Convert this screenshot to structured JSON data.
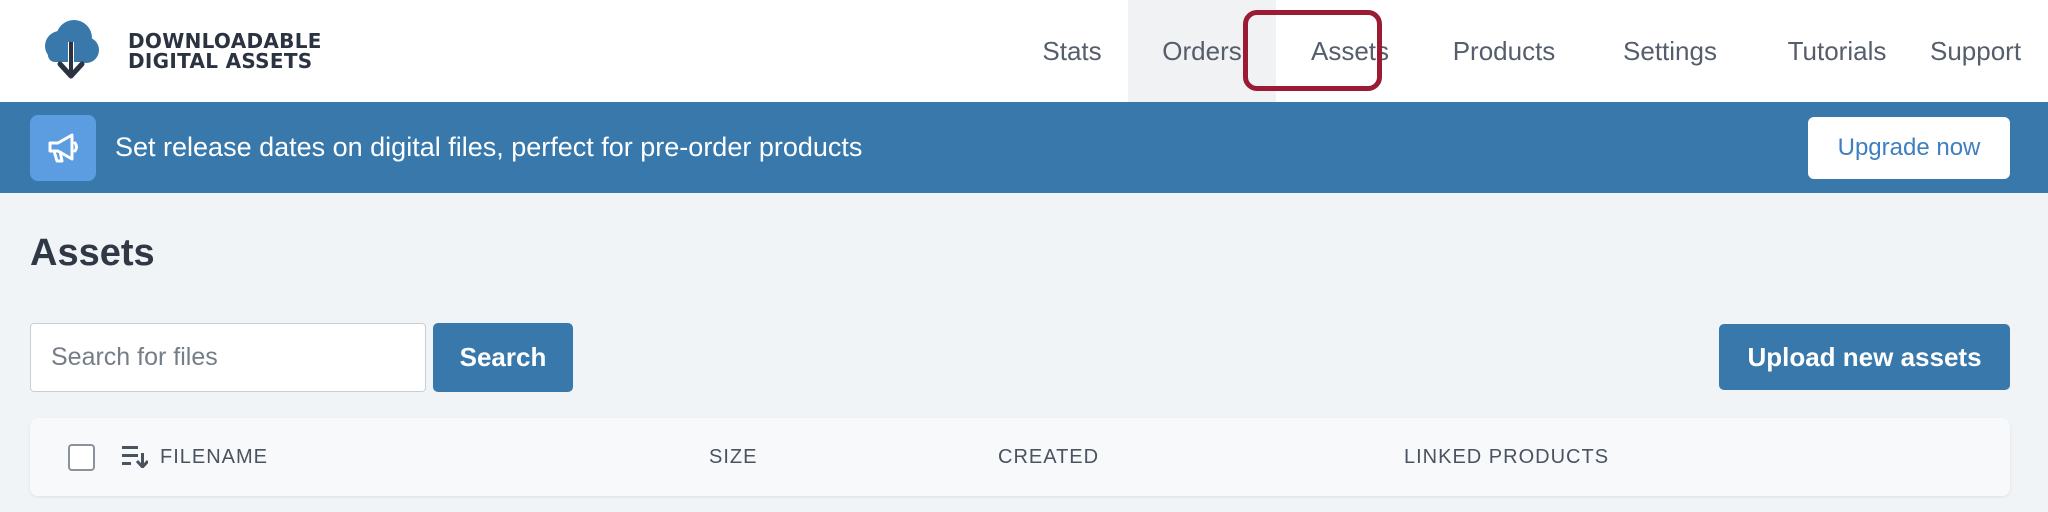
{
  "brand": {
    "line1": "DOWNLOADABLE",
    "line2": "DIGITAL ASSETS",
    "icon": "cloud-download-icon"
  },
  "nav": {
    "items": [
      {
        "label": "Stats"
      },
      {
        "label": "Orders"
      },
      {
        "label": "Assets"
      },
      {
        "label": "Products"
      },
      {
        "label": "Settings"
      },
      {
        "label": "Tutorials"
      },
      {
        "label": "Support"
      }
    ],
    "highlighted": "Assets",
    "highlight_color": "#9b1b35"
  },
  "banner": {
    "icon": "megaphone-icon",
    "text": "Set release dates on digital files, perfect for pre-order products",
    "button_label": "Upgrade now",
    "background": "#3878ab"
  },
  "main": {
    "title": "Assets",
    "search": {
      "placeholder": "Search for files",
      "value": "",
      "button_label": "Search"
    },
    "upload_button_label": "Upload new assets",
    "table": {
      "columns": [
        "FILENAME",
        "SIZE",
        "CREATED",
        "LINKED PRODUCTS"
      ],
      "sort_icon": "sort-icon"
    }
  },
  "colors": {
    "primary": "#3878ab",
    "page_background": "#f1f4f7"
  }
}
